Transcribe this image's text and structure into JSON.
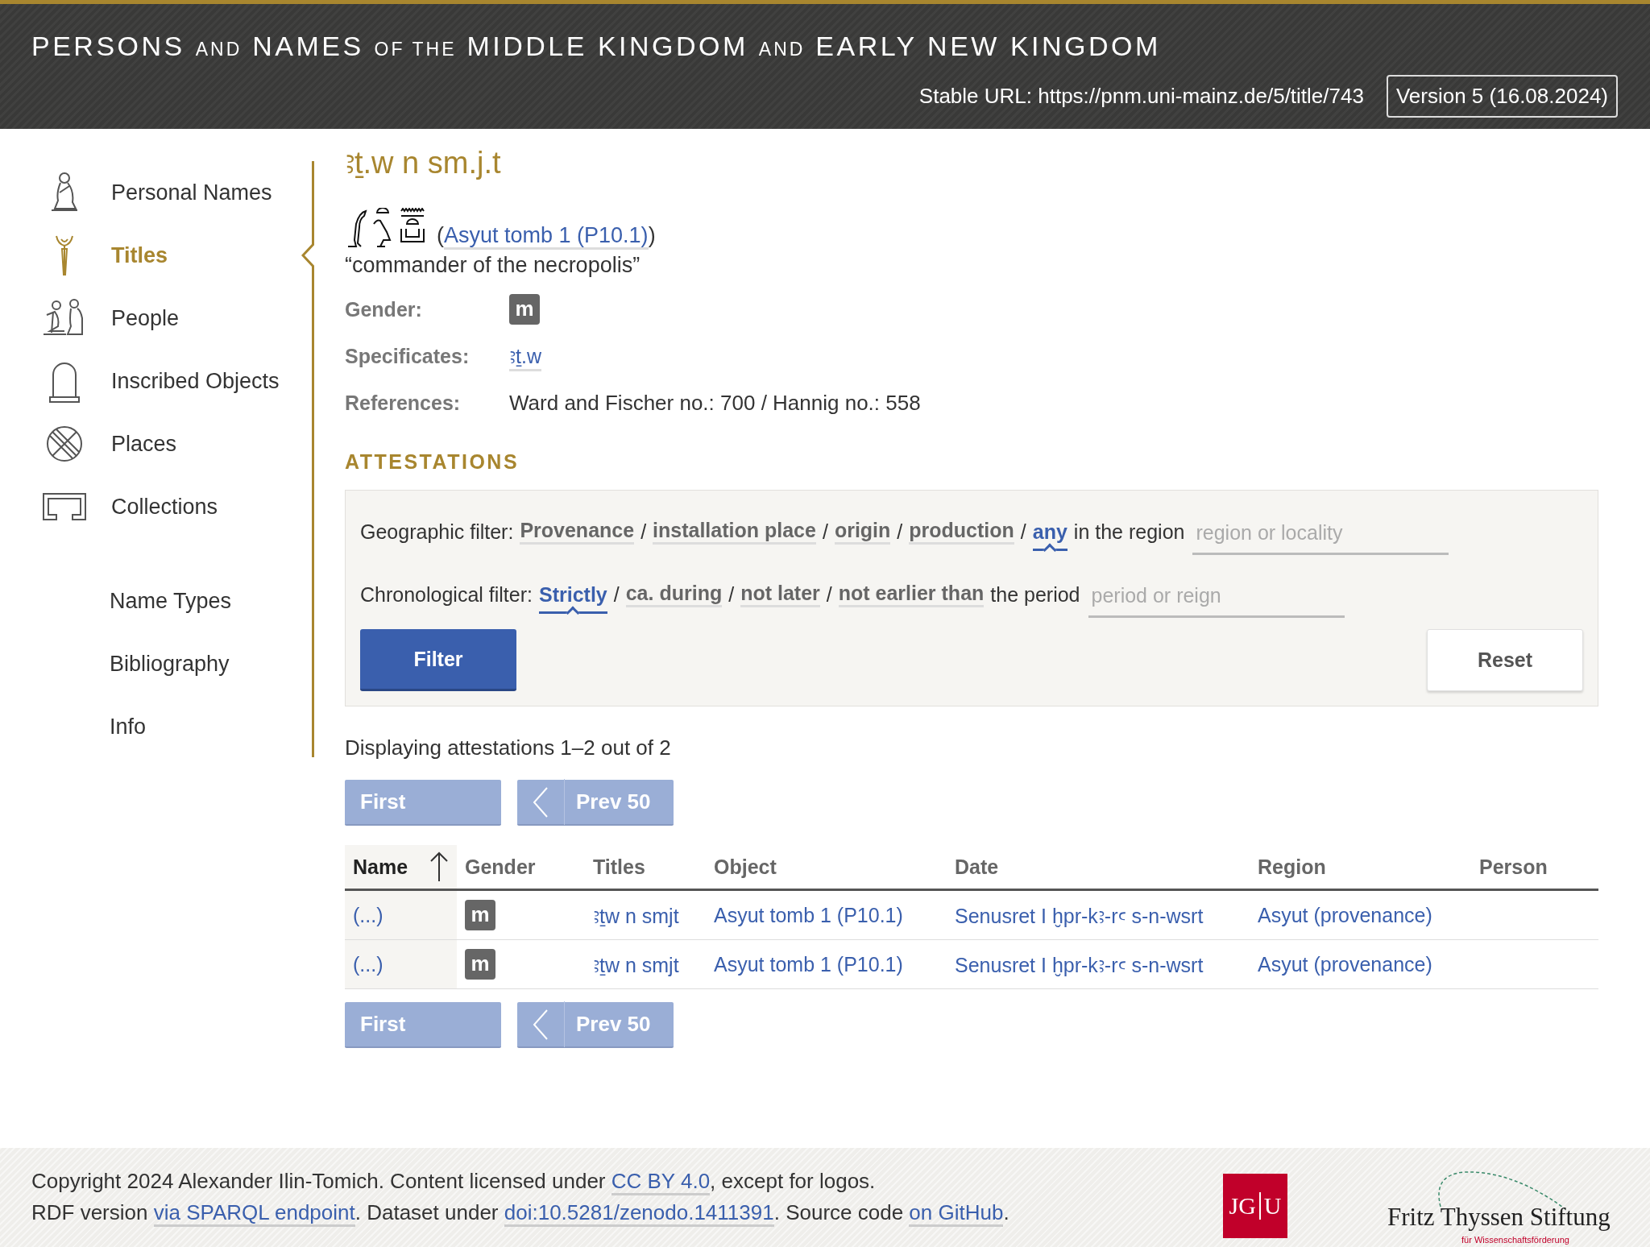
{
  "header": {
    "title": [
      {
        "text": "PERSONS",
        "kind": "major"
      },
      {
        "text": "AND",
        "kind": "minor"
      },
      {
        "text": "NAMES",
        "kind": "major"
      },
      {
        "text": "OF THE",
        "kind": "minor"
      },
      {
        "text": "MIDDLE KINGDOM",
        "kind": "major"
      },
      {
        "text": "AND",
        "kind": "minor"
      },
      {
        "text": "EARLY NEW KINGDOM",
        "kind": "major"
      }
    ],
    "stable_url": "Stable URL: https://pnm.uni-mainz.de/5/title/743",
    "version": "Version 5 (16.08.2024)"
  },
  "sidebar": {
    "items": [
      {
        "label": "Personal Names",
        "selected": false
      },
      {
        "label": "Titles",
        "selected": true
      },
      {
        "label": "People",
        "selected": false
      },
      {
        "label": "Inscribed Objects",
        "selected": false
      },
      {
        "label": "Places",
        "selected": false
      },
      {
        "label": "Collections",
        "selected": false
      }
    ],
    "secondary_items": [
      {
        "label": "Name Types",
        "selected": false
      },
      {
        "label": "Bibliography",
        "selected": false
      },
      {
        "label": "Info",
        "selected": false
      }
    ]
  },
  "title": {
    "heading": "ꜣṯ.w n sm.j.t",
    "source": {
      "open": "(",
      "link": "Asyut tomb 1 (P10.1)",
      "close": ")"
    },
    "translation": "“commander of the necropolis”",
    "fields": [
      {
        "label": "Gender:",
        "kind": "badge",
        "value": "m"
      },
      {
        "label": "Specificates:",
        "kind": "link",
        "value": "ꜣṯ.w"
      },
      {
        "label": "References:",
        "kind": "text",
        "value": "Ward and Fischer no.: 700 / Hannig no.: 558"
      }
    ]
  },
  "attestations": {
    "heading": "ATTESTATIONS",
    "filters": [
      {
        "label": "Geographic filter:",
        "separator": "/",
        "options": [
          {
            "label": "Provenance",
            "selected": false
          },
          {
            "label": "installation place",
            "selected": false
          },
          {
            "label": "origin",
            "selected": false
          },
          {
            "label": "production",
            "selected": false
          },
          {
            "label": "any",
            "selected": true
          }
        ],
        "suffix": "in the region",
        "placeholder": "region or locality"
      },
      {
        "label": "Chronological filter:",
        "separator": "/",
        "options": [
          {
            "label": "Strictly",
            "selected": true
          },
          {
            "label": "ca. during",
            "selected": false
          },
          {
            "label": "not later",
            "selected": false
          },
          {
            "label": "not earlier than",
            "selected": false
          }
        ],
        "suffix": "the period",
        "placeholder": "period or reign"
      }
    ],
    "buttons": [
      {
        "label": "Filter",
        "kind": "primary"
      },
      {
        "label": "Reset",
        "kind": "secondary"
      }
    ],
    "summary": "Displaying attestations 1–2 out of 2",
    "pager_top": [
      {
        "label": "First",
        "kind": "first",
        "disabled": true
      },
      {
        "label": "Prev 50",
        "kind": "prev",
        "disabled": true
      }
    ],
    "table": {
      "columns": [
        {
          "label": "Name",
          "sorted": true
        },
        {
          "label": "Gender",
          "sorted": false
        },
        {
          "label": "Titles",
          "sorted": false
        },
        {
          "label": "Object",
          "sorted": false
        },
        {
          "label": "Date",
          "sorted": false
        },
        {
          "label": "Region",
          "sorted": false
        },
        {
          "label": "Person",
          "sorted": false
        }
      ],
      "rows": [
        {
          "name": "(...)",
          "gender": "m",
          "titles": "ꜣṯw n smjt",
          "object": "Asyut tomb 1 (P10.1)",
          "date": "Senusret I ḫpr-kꜣ-rꜥ s-n-wsrt",
          "region": "Asyut (provenance)"
        },
        {
          "name": "(...)",
          "gender": "m",
          "titles": "ꜣṯw n smjt",
          "object": "Asyut tomb 1 (P10.1)",
          "date": "Senusret I ḫpr-kꜣ-rꜥ s-n-wsrt",
          "region": "Asyut (provenance)"
        }
      ]
    },
    "pager_bottom": [
      {
        "label": "First",
        "kind": "first",
        "disabled": true
      },
      {
        "label": "Prev 50",
        "kind": "prev",
        "disabled": true
      }
    ]
  },
  "footer": {
    "lines": [
      [
        {
          "kind": "text",
          "text": "Copyright 2024 Alexander Ilin-Tomich. Content licensed under "
        },
        {
          "kind": "link",
          "text": "CC BY 4.0"
        },
        {
          "kind": "text",
          "text": ", except for logos."
        }
      ],
      [
        {
          "kind": "text",
          "text": "RDF version "
        },
        {
          "kind": "link",
          "text": "via SPARQL endpoint"
        },
        {
          "kind": "text",
          "text": ". Dataset under "
        },
        {
          "kind": "link",
          "text": "doi:10.5281/zenodo.1411391"
        },
        {
          "kind": "text",
          "text": ". Source code "
        },
        {
          "kind": "link",
          "text": "on GitHub"
        },
        {
          "kind": "text",
          "text": "."
        }
      ]
    ],
    "university_logo": [
      "JG",
      "U"
    ],
    "foundation_logo": {
      "name": "Fritz Thyssen Stiftung",
      "tagline": "für Wissenschaftsförderung"
    }
  }
}
